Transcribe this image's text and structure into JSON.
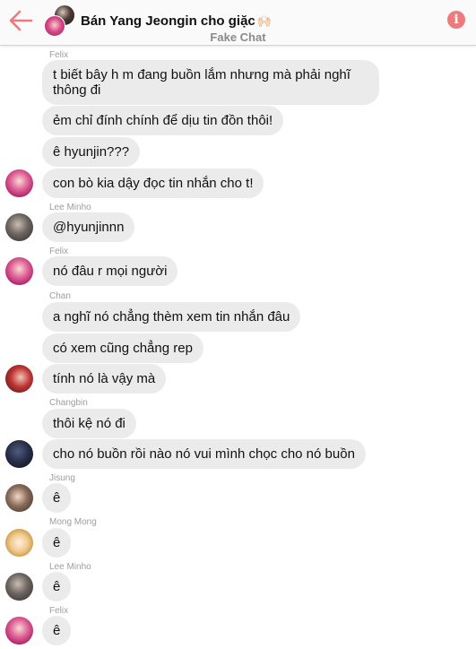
{
  "header": {
    "title": "Bán Yang Jeongin cho giặc",
    "title_emoji": "🙌🏻",
    "subtitle": "Fake Chat",
    "back_icon": "arrow-left-icon",
    "info_icon": "info-icon",
    "info_symbol": "i",
    "accent_color": "#ed7b7b"
  },
  "messages": [
    {
      "sender": "Felix",
      "text": "t biết bây h m đang buồn lắm nhưng mà phải nghĩ thông đi"
    },
    {
      "text": "ẻm chỉ đính chính để dịu tin đồn thôi!"
    },
    {
      "text": "ê hyunjin???"
    },
    {
      "text": "con bò kia dậy đọc tin nhắn cho t!"
    },
    {
      "sender": "Lee Minho",
      "text": "@hyunjinnn"
    },
    {
      "sender": "Felix",
      "text": "nó đâu r mọi người"
    },
    {
      "sender": "Chan",
      "text": "a nghĩ nó chẳng thèm xem tin nhắn đâu"
    },
    {
      "text": "có xem cũng chẳng rep"
    },
    {
      "text": "tính nó là vậy mà"
    },
    {
      "sender": "Changbin",
      "text": "thôi kệ nó đi"
    },
    {
      "text": "cho nó buồn rồi nào nó vui mình chọc cho nó buồn"
    },
    {
      "sender": "Jisung",
      "text": "ê"
    },
    {
      "sender": "Mong Mong",
      "text": "ê"
    },
    {
      "sender": "Lee Minho",
      "text": "ê"
    },
    {
      "sender": "Felix",
      "text": "ê"
    }
  ]
}
